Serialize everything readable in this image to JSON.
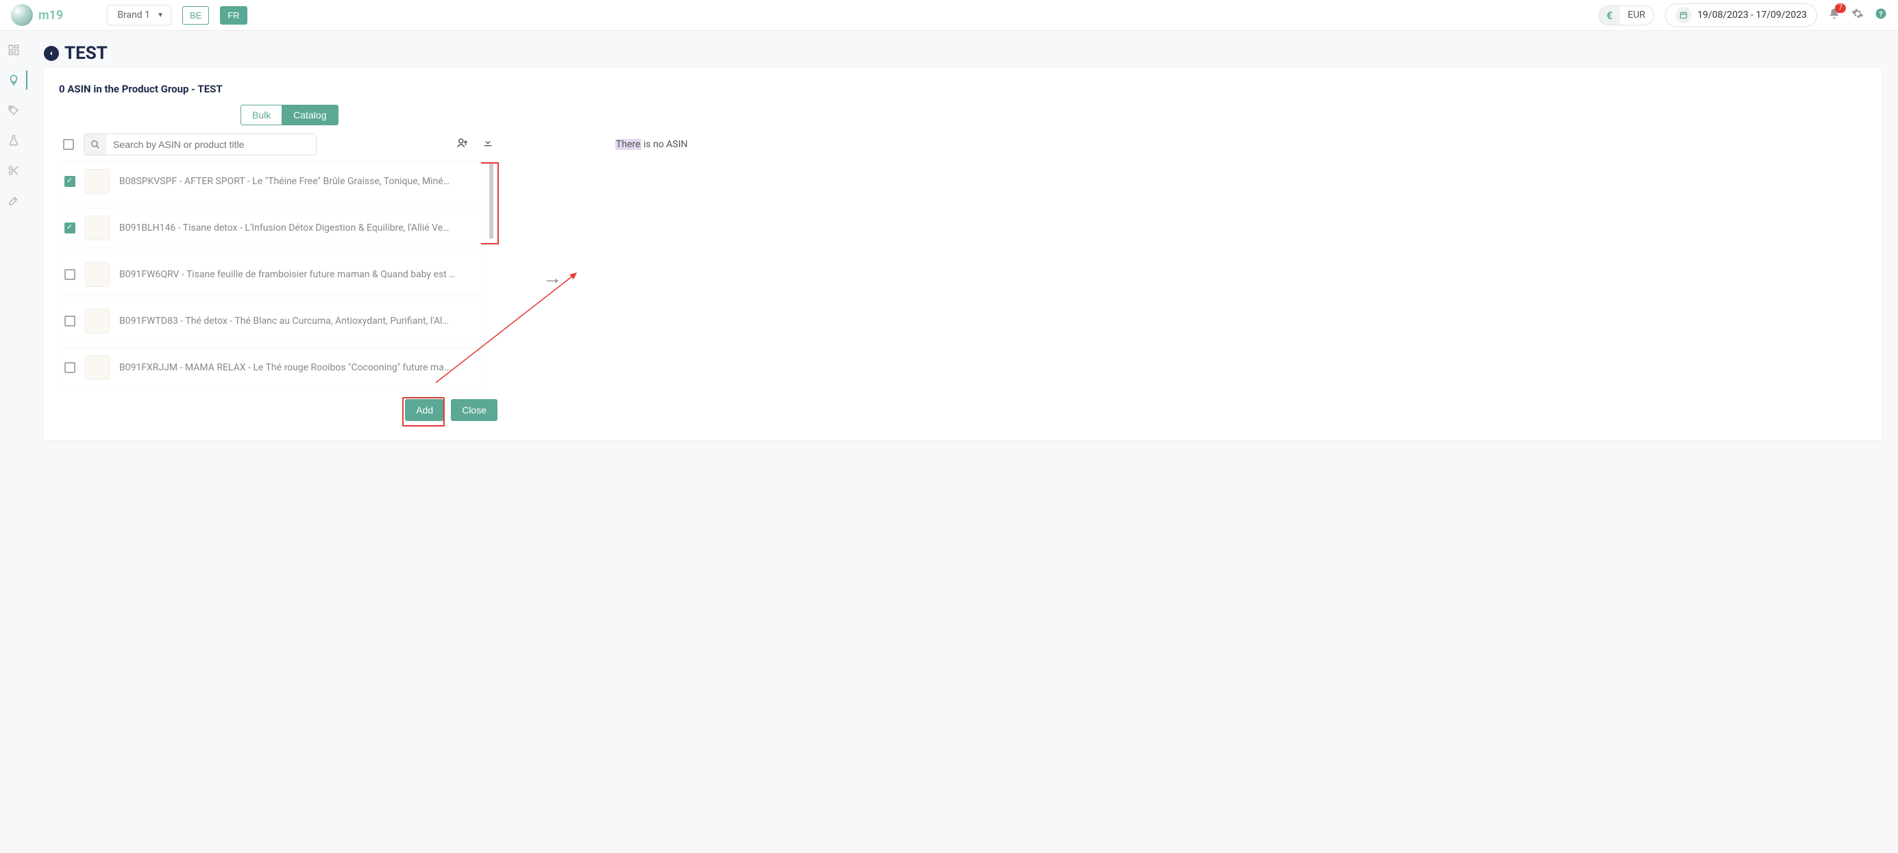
{
  "header": {
    "logo_text": "m19",
    "brand_label": "Brand 1",
    "lang_be": "BE",
    "lang_fr": "FR",
    "currency_symbol": "€",
    "currency_code": "EUR",
    "date_range": "19/08/2023 - 17/09/2023",
    "notification_count": "7"
  },
  "page": {
    "title": "TEST",
    "card_title": "0 ASIN in the Product Group - TEST",
    "tab_bulk": "Bulk",
    "tab_catalog": "Catalog",
    "search_placeholder": "Search by ASIN or product title",
    "btn_add": "Add",
    "btn_close": "Close",
    "no_asin_highlight": "There",
    "no_asin_rest": " is no ASIN"
  },
  "catalog_items": [
    {
      "checked": true,
      "title": "B08SPKVSPF - AFTER SPORT - Le \"Théine Free\" Brûle Graisse, Tonique, Miné…"
    },
    {
      "checked": true,
      "title": "B091BLH146 - Tisane detox - L'Infusion Détox Digestion & Equilibre, l'Allié Ve…"
    },
    {
      "checked": false,
      "title": "B091FW6QRV - Tisane feuille de framboisier future maman & Quand baby est …"
    },
    {
      "checked": false,
      "title": "B091FWTD83 - Thé detox - Thé Blanc au Curcuma, Antioxydant, Purifiant, l'Al…"
    },
    {
      "checked": false,
      "title": "B091FXRJJM - MAMA RELAX - Le Thé rouge Rooibos \"Cocooning\" future ma…"
    }
  ]
}
